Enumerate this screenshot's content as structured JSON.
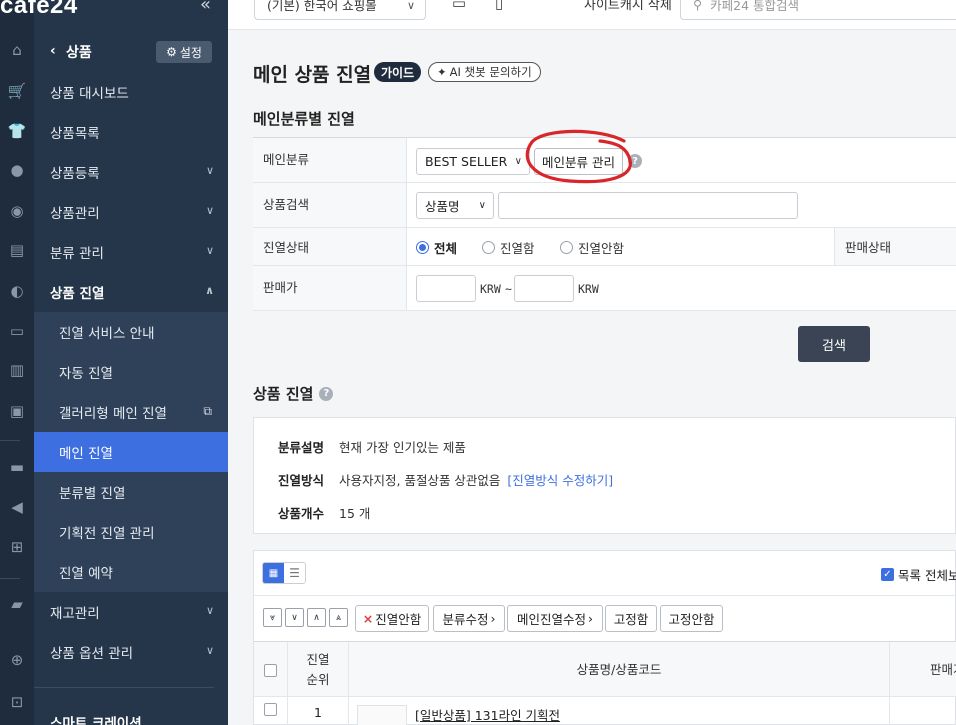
{
  "logo": "cafe24",
  "topbar": {
    "mall_select": "(기본) 한국어 쇼핑몰",
    "cache_delete": "사이트캐시 삭제",
    "search_placeholder": "카페24 통합검색"
  },
  "sidebar": {
    "back_title": "상품",
    "settings_label": "설정",
    "items": [
      {
        "label": "상품 대시보드"
      },
      {
        "label": "상품목록"
      },
      {
        "label": "상품등록"
      },
      {
        "label": "상품관리"
      },
      {
        "label": "분류 관리"
      },
      {
        "label": "상품 진열"
      },
      {
        "label": "진열 서비스 안내"
      },
      {
        "label": "자동 진열"
      },
      {
        "label": "갤러리형 메인 진열"
      },
      {
        "label": "메인 진열"
      },
      {
        "label": "분류별 진열"
      },
      {
        "label": "기획전 진열 관리"
      },
      {
        "label": "진열 예약"
      },
      {
        "label": "재고관리"
      },
      {
        "label": "상품 옵션 관리"
      },
      {
        "label": "스마트 크레이션"
      }
    ]
  },
  "page": {
    "title": "메인 상품 진열",
    "guide_badge": "가이드",
    "ai_badge": "AI 챗봇 문의하기",
    "section1_title": "메인분류별 진열",
    "section2_title": "상품 진열"
  },
  "form": {
    "main_category_label": "메인분류",
    "main_category_value": "BEST SELLER",
    "manage_button": "메인분류 관리",
    "product_search_label": "상품검색",
    "search_type_value": "상품명",
    "display_status_label": "진열상태",
    "status_options": [
      "전체",
      "진열함",
      "진열안함"
    ],
    "selected_status": "전체",
    "sale_status_label": "판매상태",
    "price_label": "판매가",
    "currency": "KRW",
    "range_separator": "~",
    "search_button": "검색"
  },
  "info": {
    "desc_label": "분류설명",
    "desc_value": "현재 가장 인기있는 제품",
    "method_label": "진열방식",
    "method_value": "사용자지정, 품절상품 상관없음",
    "method_link": "[진열방식 수정하기]",
    "count_label": "상품개수",
    "count_value": "15 개"
  },
  "list": {
    "show_all_label": "목록 전체보기",
    "actions": [
      "진열안함",
      "분류수정",
      "메인진열수정",
      "고정함",
      "고정안함"
    ],
    "columns": [
      "진열\n순위",
      "상품명/상품코드",
      "판매가"
    ],
    "rows": [
      {
        "rank": "1",
        "name": "[일반상품] 131라인 기획전"
      }
    ]
  },
  "colors": {
    "sidebar_bg": "#26364a",
    "rail_bg": "#1f2c3d",
    "accent": "#3d6fe0",
    "annotation": "#d8262a"
  }
}
